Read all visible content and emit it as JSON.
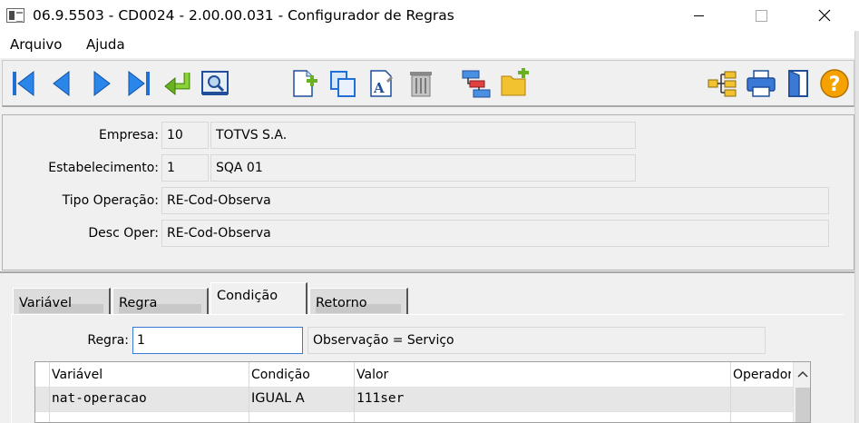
{
  "window": {
    "title": "06.9.5503 - CD0024 - 2.00.00.031 - Configurador de Regras"
  },
  "menu": {
    "arquivo": "Arquivo",
    "ajuda": "Ajuda"
  },
  "toolbar": {
    "icons": [
      "first-record-icon",
      "previous-record-icon",
      "next-record-icon",
      "last-record-icon",
      "goto-icon",
      "search-icon",
      "new-record-icon",
      "copy-icon",
      "edit-icon",
      "delete-icon",
      "relations-icon",
      "new-folder-icon",
      "tree-icon",
      "print-icon",
      "exit-icon",
      "help-icon"
    ],
    "colors": {
      "blue": "#1f6fd6",
      "green": "#6ab023",
      "yellow": "#f0c020",
      "help": "#f5a200"
    }
  },
  "header": {
    "empresa_label": "Empresa:",
    "empresa_code": "10",
    "empresa_name": "TOTVS S.A.",
    "estab_label": "Estabelecimento:",
    "estab_code": "1",
    "estab_name": "SQA 01",
    "tipo_label": "Tipo Operação:",
    "tipo_value": "RE-Cod-Observa",
    "desc_label": "Desc Oper:",
    "desc_value": "RE-Cod-Observa"
  },
  "tabs": [
    {
      "label": "Variável"
    },
    {
      "label": "Regra"
    },
    {
      "label": "Condição"
    },
    {
      "label": "Retorno"
    }
  ],
  "condicao": {
    "regra_label": "Regra:",
    "regra_value": "1",
    "regra_desc": "Observação = Serviço",
    "grid": {
      "columns": [
        "Variável",
        "Condição",
        "Valor",
        "Operador"
      ],
      "rows": [
        [
          "nat-operacao",
          "IGUAL A",
          "111ser",
          ""
        ]
      ]
    }
  }
}
